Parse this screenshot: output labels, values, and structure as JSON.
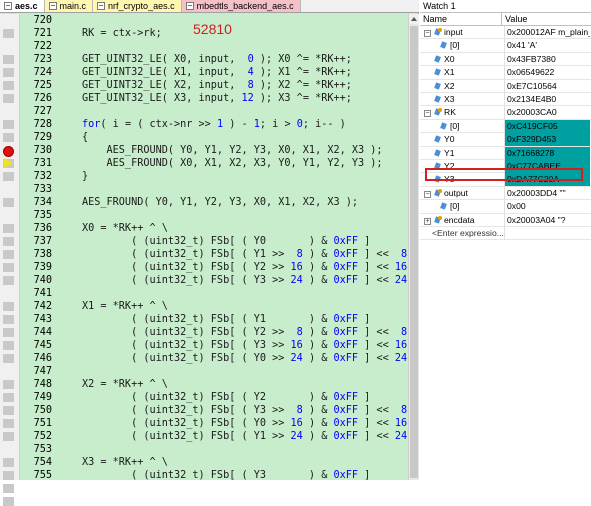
{
  "editor": {
    "tabs": [
      {
        "label": "aes.c",
        "active": true
      },
      {
        "label": "main.c",
        "active": false
      },
      {
        "label": "nrf_crypto_aes.c",
        "active": false
      },
      {
        "label": "mbedtls_backend_aes.c",
        "active": false
      }
    ],
    "annotation": "52810",
    "lines": [
      {
        "num": "720",
        "code": ""
      },
      {
        "num": "721",
        "code": "RK = ctx->rk;"
      },
      {
        "num": "722",
        "code": ""
      },
      {
        "num": "723",
        "code": "GET_UINT32_LE( X0, input,  0 ); X0 ^= *RK++;"
      },
      {
        "num": "724",
        "code": "GET_UINT32_LE( X1, input,  4 ); X1 ^= *RK++;"
      },
      {
        "num": "725",
        "code": "GET_UINT32_LE( X2, input,  8 ); X2 ^= *RK++;"
      },
      {
        "num": "726",
        "code": "GET_UINT32_LE( X3, input, 12 ); X3 ^= *RK++;"
      },
      {
        "num": "727",
        "code": ""
      },
      {
        "num": "728",
        "code": "for( i = ( ctx->nr >> 1 ) - 1; i > 0; i-- )"
      },
      {
        "num": "729",
        "code": "{"
      },
      {
        "num": "730",
        "code": "    AES_FROUND( Y0, Y1, Y2, Y3, X0, X1, X2, X3 );"
      },
      {
        "num": "731",
        "code": "    AES_FROUND( X0, X1, X2, X3, Y0, Y1, Y2, Y3 );"
      },
      {
        "num": "732",
        "code": "}"
      },
      {
        "num": "733",
        "code": ""
      },
      {
        "num": "734",
        "code": "AES_FROUND( Y0, Y1, Y2, Y3, X0, X1, X2, X3 );"
      },
      {
        "num": "735",
        "code": ""
      },
      {
        "num": "736",
        "code": "X0 = *RK++ ^ \\"
      },
      {
        "num": "737",
        "code": "        ( (uint32_t) FSb[ ( Y0       ) & 0xFF ]       ) ^"
      },
      {
        "num": "738",
        "code": "        ( (uint32_t) FSb[ ( Y1 >>  8 ) & 0xFF ] <<  8 ) ^"
      },
      {
        "num": "739",
        "code": "        ( (uint32_t) FSb[ ( Y2 >> 16 ) & 0xFF ] << 16 ) ^"
      },
      {
        "num": "740",
        "code": "        ( (uint32_t) FSb[ ( Y3 >> 24 ) & 0xFF ] << 24 );"
      },
      {
        "num": "741",
        "code": ""
      },
      {
        "num": "742",
        "code": "X1 = *RK++ ^ \\"
      },
      {
        "num": "743",
        "code": "        ( (uint32_t) FSb[ ( Y1       ) & 0xFF ]       ) ^"
      },
      {
        "num": "744",
        "code": "        ( (uint32_t) FSb[ ( Y2 >>  8 ) & 0xFF ] <<  8 ) ^"
      },
      {
        "num": "745",
        "code": "        ( (uint32_t) FSb[ ( Y3 >> 16 ) & 0xFF ] << 16 ) ^"
      },
      {
        "num": "746",
        "code": "        ( (uint32_t) FSb[ ( Y0 >> 24 ) & 0xFF ] << 24 );"
      },
      {
        "num": "747",
        "code": ""
      },
      {
        "num": "748",
        "code": "X2 = *RK++ ^ \\"
      },
      {
        "num": "749",
        "code": "        ( (uint32_t) FSb[ ( Y2       ) & 0xFF ]       ) ^"
      },
      {
        "num": "750",
        "code": "        ( (uint32_t) FSb[ ( Y3 >>  8 ) & 0xFF ] <<  8 ) ^"
      },
      {
        "num": "751",
        "code": "        ( (uint32_t) FSb[ ( Y0 >> 16 ) & 0xFF ] << 16 ) ^"
      },
      {
        "num": "752",
        "code": "        ( (uint32_t) FSb[ ( Y1 >> 24 ) & 0xFF ] << 24 );"
      },
      {
        "num": "753",
        "code": ""
      },
      {
        "num": "754",
        "code": "X3 = *RK++ ^ \\"
      },
      {
        "num": "755",
        "code": "        ( (uint32_t) FSb[ ( Y3       ) & 0xFF ]       ) ^"
      },
      {
        "num": "756",
        "code": "        ( (uint32_t) FSb[ ( Y0 >>  8 ) & 0xFF ] <<  8 ) ^"
      },
      {
        "num": "757",
        "code": "        ( (uint32_t) FSb[ ( Y1 >> 16 ) & 0xFF ] << 16 ) ^"
      }
    ]
  },
  "watch": {
    "title": "Watch 1",
    "col_name": "Name",
    "col_value": "Value",
    "rows": [
      {
        "name": "input",
        "value": "0x200012AF m_plain_t...",
        "expand": "minus",
        "icon": "star",
        "indent": 0
      },
      {
        "name": "[0]",
        "value": "0x41 'A'",
        "expand": "",
        "icon": "var",
        "indent": 1
      },
      {
        "name": "X0",
        "value": "0x43FB7380",
        "expand": "",
        "icon": "var",
        "indent": 0
      },
      {
        "name": "X1",
        "value": "0x06549622",
        "expand": "",
        "icon": "var",
        "indent": 0
      },
      {
        "name": "X2",
        "value": "0xE7C10564",
        "expand": "",
        "icon": "var",
        "indent": 0
      },
      {
        "name": "X3",
        "value": "0x2134E4B0",
        "expand": "",
        "icon": "var",
        "indent": 0
      },
      {
        "name": "RK",
        "value": "0x20003CA0",
        "expand": "minus",
        "icon": "star",
        "indent": 0
      },
      {
        "name": "[0]",
        "value": "0xC419CF05",
        "expand": "",
        "icon": "var",
        "indent": 1,
        "highlight": true
      },
      {
        "name": "Y0",
        "value": "0xF329D453",
        "expand": "",
        "icon": "var",
        "indent": 0,
        "highlight": true
      },
      {
        "name": "Y1",
        "value": "0x71668278",
        "expand": "",
        "icon": "var",
        "indent": 0,
        "highlight": true
      },
      {
        "name": "Y2",
        "value": "0xC77CABEE",
        "expand": "",
        "icon": "var",
        "indent": 0,
        "highlight": true
      },
      {
        "name": "Y3",
        "value": "0xDA77C20A",
        "expand": "",
        "icon": "var",
        "indent": 0,
        "highlight": true
      },
      {
        "name": "output",
        "value": "0x20003DD4 \"\"",
        "expand": "minus",
        "icon": "star",
        "indent": 0
      },
      {
        "name": "[0]",
        "value": "0x00",
        "expand": "",
        "icon": "var",
        "indent": 1
      },
      {
        "name": "encdata",
        "value": "0x20003A04 \"?",
        "expand": "plus",
        "icon": "star",
        "indent": 0
      },
      {
        "name": "<Enter expressio...",
        "value": "",
        "expand": "",
        "icon": "none",
        "indent": 0
      }
    ]
  },
  "colors": {
    "editor_bg": "#c7edcc",
    "highlight": "#00a0a0",
    "box": "#d02020"
  }
}
